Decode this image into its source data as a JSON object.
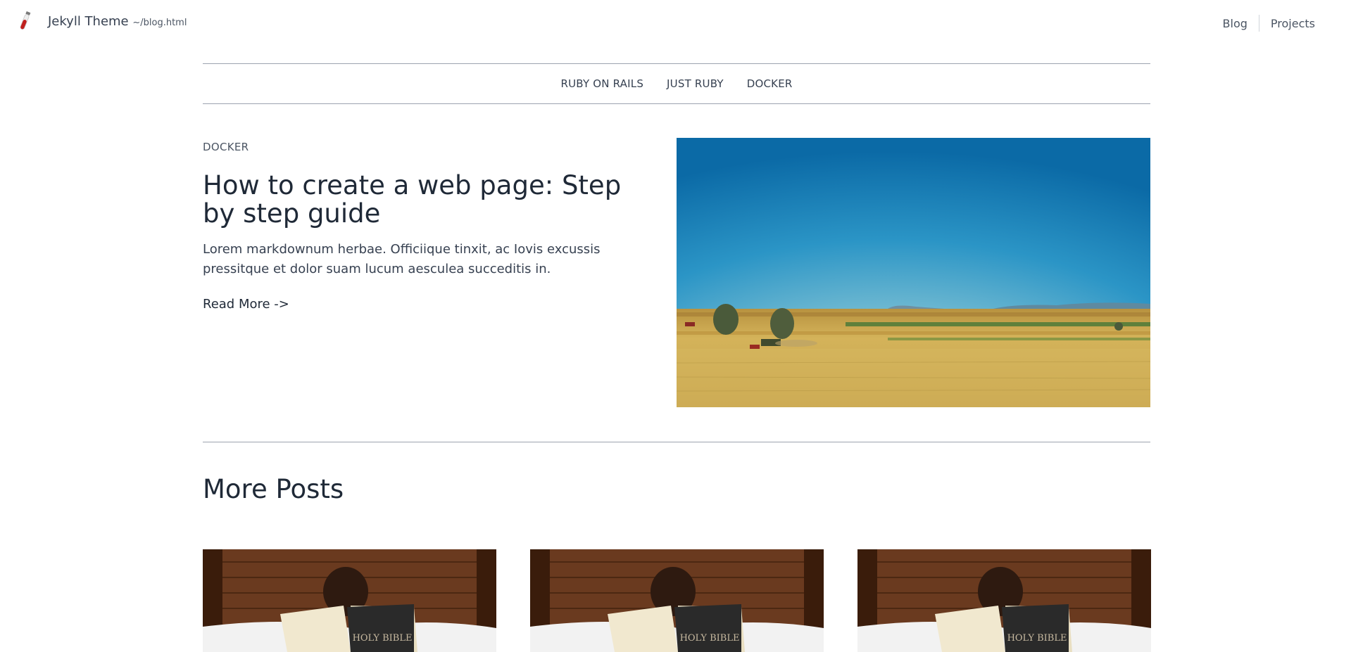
{
  "header": {
    "brand_name": "Jekyll Theme",
    "brand_path": "~/blog.html",
    "logo_icon": "test-tube-icon",
    "nav": [
      "Blog",
      "Projects"
    ]
  },
  "categories": [
    "RUBY ON RAILS",
    "JUST RUBY",
    "DOCKER"
  ],
  "featured": {
    "category": "DOCKER",
    "title": "How to create a web page: Step by step guide",
    "excerpt": "Lorem markdownum herbae. Officiique tinxit, ac Iovis excussis pressitque et dolor suam lucum aesculea succeditis in.",
    "read_more": "Read More ->",
    "image_alt": "Wheat field with tractor under blue sky"
  },
  "more_posts": {
    "title": "More Posts",
    "cards": [
      {
        "image_alt": "Child reading Holy Bible",
        "book_text": "HOLY BIBLE"
      },
      {
        "image_alt": "Child reading Holy Bible",
        "book_text": "HOLY BIBLE"
      },
      {
        "image_alt": "Child reading Holy Bible",
        "book_text": "HOLY BIBLE"
      }
    ]
  },
  "colors": {
    "text": "#1f2937",
    "muted": "#4b5563",
    "rule": "#9ca3af",
    "sky": "#1e7fb6",
    "field": "#c9a84a"
  }
}
